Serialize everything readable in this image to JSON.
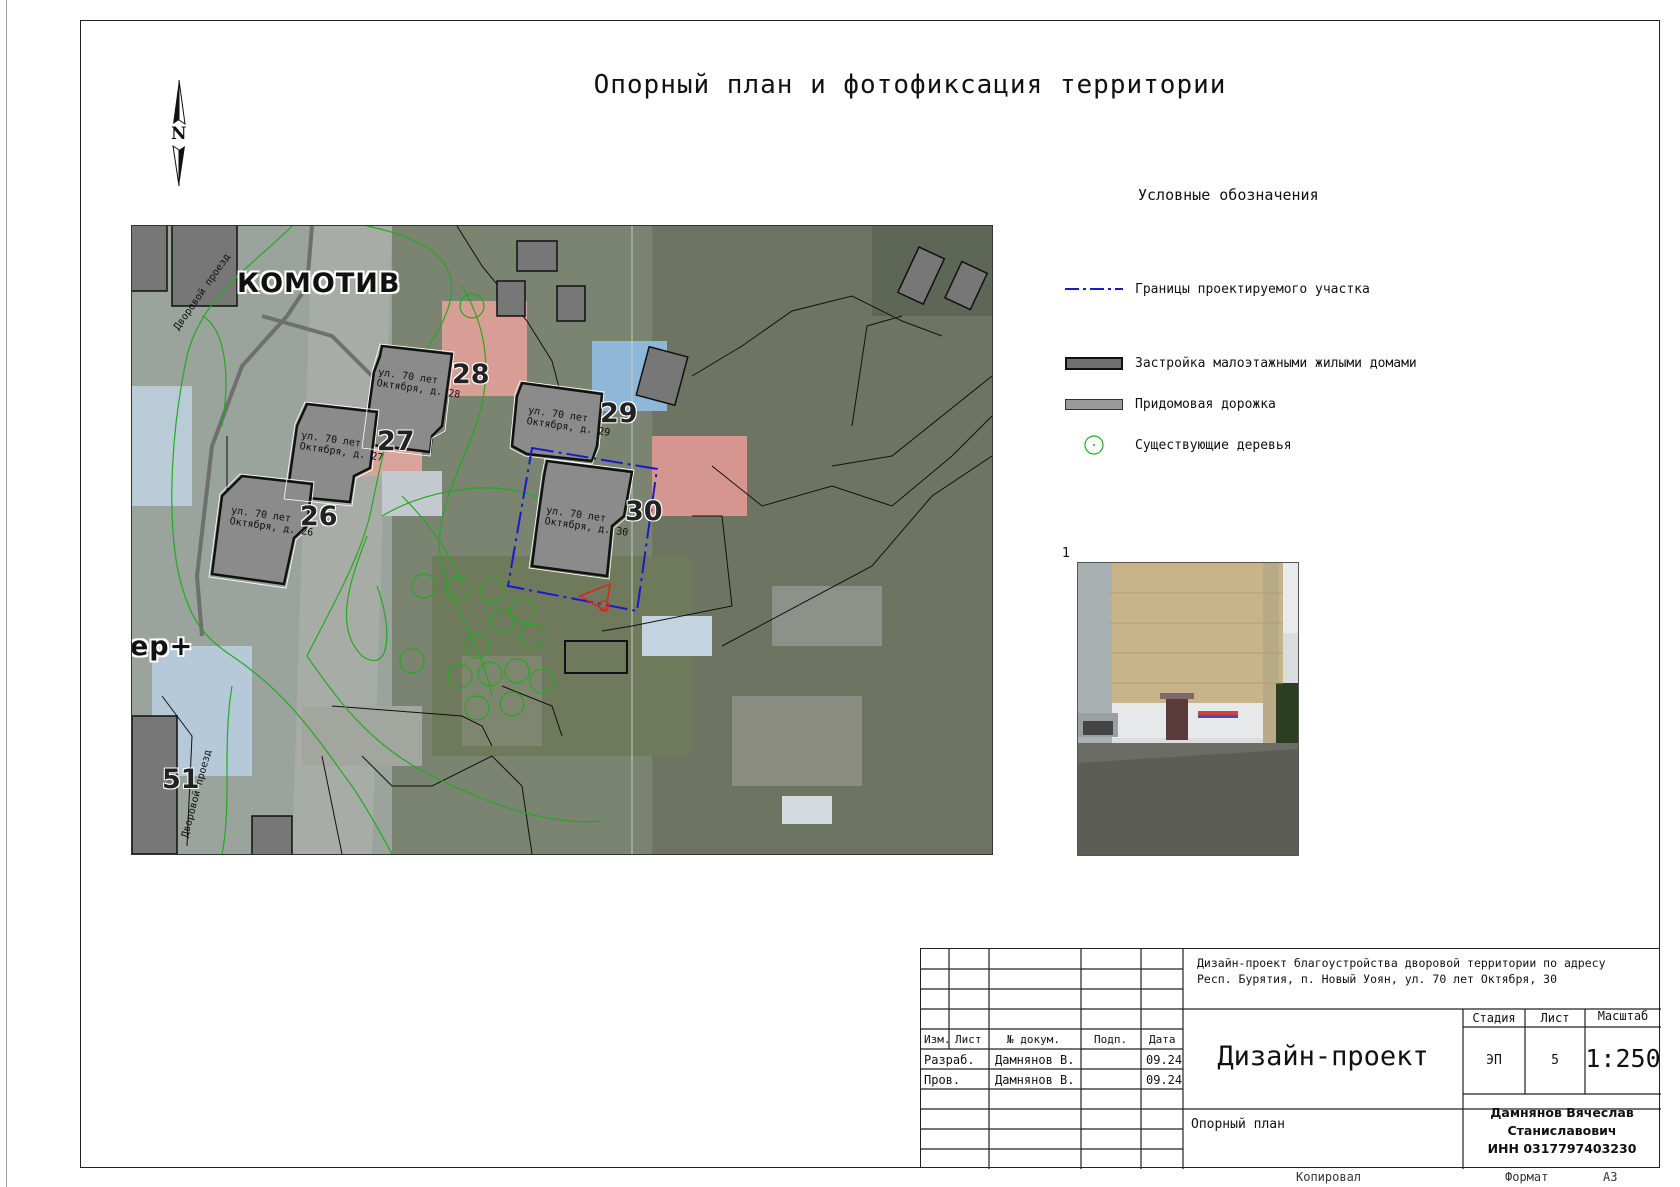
{
  "sheet": {
    "title": "Опорный план и фотофиксация территории",
    "north_letter": "N"
  },
  "map": {
    "district_label": "КОМОТИВ",
    "shop_label": "ер+",
    "edge_number": "51",
    "road_labels": [
      "Дворовой проезд",
      "Дворовой проезд"
    ],
    "buildings": [
      {
        "line1": "ул. 70 лет",
        "line2": "Октября, д. 28",
        "number": "28"
      },
      {
        "line1": "ул. 70 лет",
        "line2": "Октября, д. 27",
        "number": "27"
      },
      {
        "line1": "ул. 70 лет",
        "line2": "Октября, д. 26",
        "number": "26"
      },
      {
        "line1": "ул. 70 лет",
        "line2": "Октября, д. 29",
        "number": "29"
      },
      {
        "line1": "ул. 70 лет",
        "line2": "Октября, д. 30",
        "number": "30"
      }
    ],
    "colors": {
      "boundary": "#1a1acc",
      "building": "#8b8b8b",
      "outline": "#111111",
      "tree": "#22aa22",
      "photo_marker": "#dd2222"
    }
  },
  "legend": {
    "title": "Условные обозначения",
    "items": [
      {
        "label": "Границы проектируемого участка",
        "symbol": "dash-dot-line"
      },
      {
        "label": "Застройка малоэтажными жилыми домами",
        "symbol": "dark-rect"
      },
      {
        "label": "Придомовая дорожка",
        "symbol": "grey-rect"
      },
      {
        "label": "Существующие деревья",
        "symbol": "tree-circle"
      }
    ]
  },
  "photo": {
    "number": "1"
  },
  "stamp": {
    "project_description": "Дизайн-проект благоустройства дворовой территории по адресу Респ. Бурятия, п. Новый Уоян, ул. 70 лет Октября, 30",
    "header": {
      "izm": "Изм.",
      "list": "Лист",
      "doc": "№ докум.",
      "podp": "Подп.",
      "date": "Дата"
    },
    "rows": [
      {
        "role": "Разраб.",
        "name": "Дамнянов В.",
        "date": "09.24"
      },
      {
        "role": "Пров.",
        "name": "Дамнянов В.",
        "date": "09.24"
      }
    ],
    "doc_type": "Дизайн-проект",
    "sheet_name": "Опорный план",
    "stage_header": "Стадия",
    "list_header": "Лист",
    "scale_header": "Масштаб",
    "stage_value": "ЭП",
    "list_value": "5",
    "scale_value": "1:250",
    "author_line1": "Дамнянов Вячеслав",
    "author_line2": "Станиславович",
    "author_line3": "ИНН 0317797403230"
  },
  "footer": {
    "copied": "Копировал",
    "format_label": "Формат",
    "format_value": "А3"
  }
}
